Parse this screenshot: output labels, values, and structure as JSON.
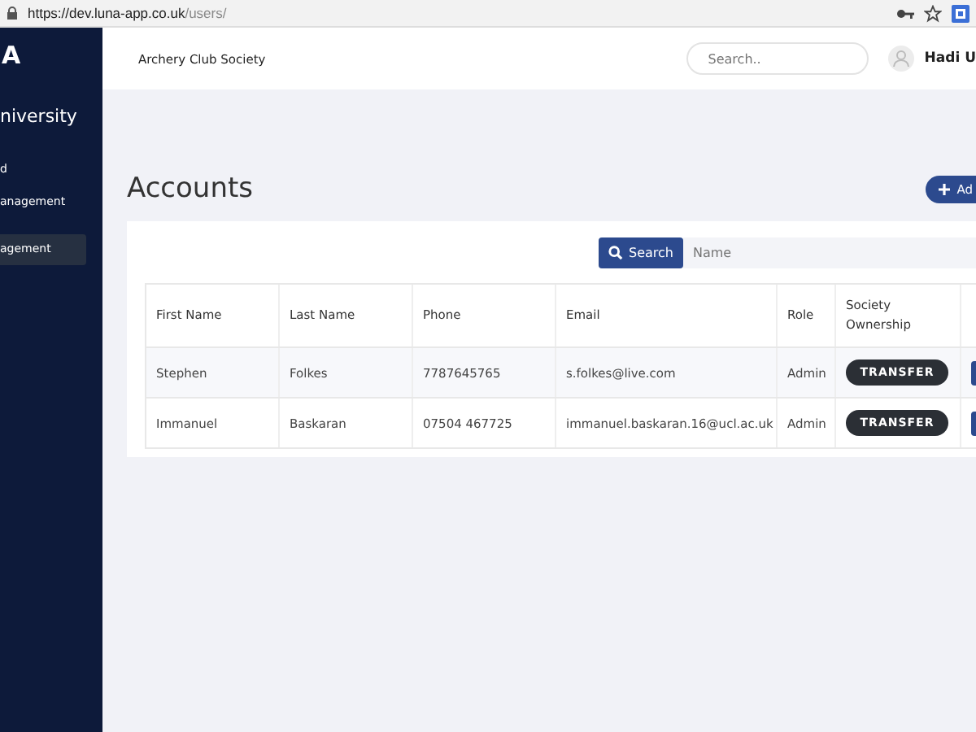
{
  "browser": {
    "url_host": "https://dev.luna-app.co.uk",
    "url_path": "/users/"
  },
  "sidebar": {
    "logo": "A",
    "title": "niversity",
    "items": [
      {
        "label": "d",
        "selected": false
      },
      {
        "label": "anagement",
        "selected": false
      },
      {
        "label": "agement",
        "selected": true
      }
    ]
  },
  "header": {
    "society": "Archery Club Society",
    "search": {
      "placeholder": "Search.."
    },
    "user": "Hadi U"
  },
  "page": {
    "title": "Accounts",
    "add_button": "Ad"
  },
  "search": {
    "button": "Search",
    "placeholder": "Name"
  },
  "table": {
    "columns": [
      "First Name",
      "Last Name",
      "Phone",
      "Email",
      "Role",
      "Society Ownership"
    ],
    "rows": [
      {
        "cells": [
          "Stephen",
          "Folkes",
          "7787645765",
          "s.folkes@live.com",
          "Admin"
        ],
        "action": "TRANSFER"
      },
      {
        "cells": [
          "Immanuel",
          "Baskaran",
          "07504 467725",
          "immanuel.baskaran.16@ucl.ac.uk",
          "Admin"
        ],
        "action": "TRANSFER"
      }
    ]
  }
}
